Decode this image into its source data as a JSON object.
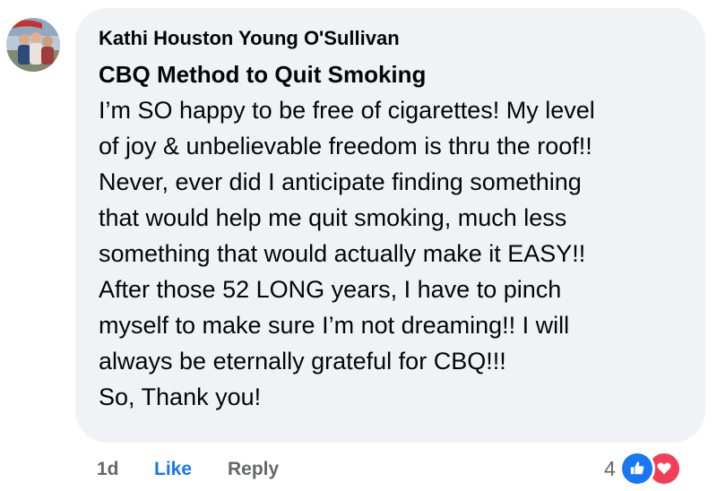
{
  "comment": {
    "author": "Kathi Houston Young O'Sullivan",
    "title": "CBQ Method to Quit Smoking",
    "body_lines": [
      "I’m SO happy to be free of cigarettes! My level",
      "of joy & unbelievable freedom is thru the roof!!",
      "Never, ever did I anticipate finding something",
      "that would help me quit smoking, much less",
      "something that would actually make it EASY!!",
      "After those 52 LONG years, I have to pinch",
      "myself to make sure I’m not dreaming!! I will",
      "always be eternally grateful for CBQ!!!",
      "So, Thank you!"
    ]
  },
  "actions": {
    "time": "1d",
    "like": "Like",
    "reply": "Reply"
  },
  "reactions": {
    "count": "4",
    "icons": [
      "thumbs-up-icon",
      "heart-icon"
    ]
  },
  "colors": {
    "bubble": "#f0f2f5",
    "text": "#050505",
    "meta": "#65676b",
    "like_blue": "#1877f2",
    "love_red": "#f33e58"
  }
}
